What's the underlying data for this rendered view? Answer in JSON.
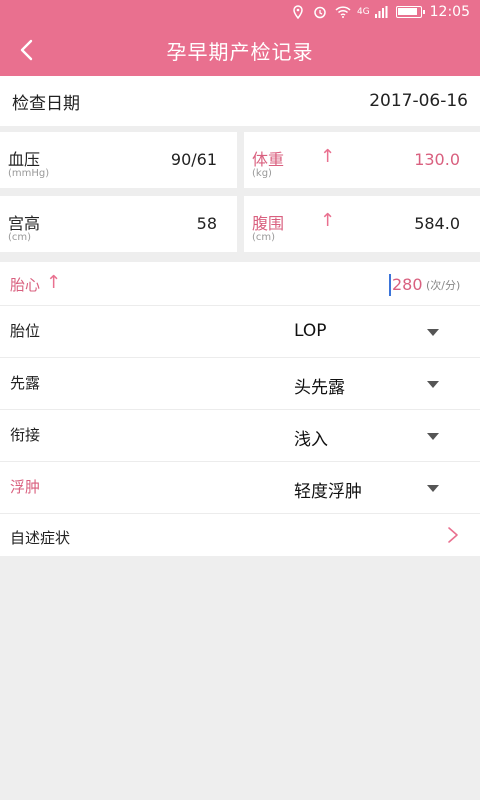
{
  "status": {
    "time": "12:05",
    "net": "4G"
  },
  "header": {
    "title": "孕早期产检记录"
  },
  "date": {
    "label": "检查日期",
    "value": "2017-06-16"
  },
  "cards": [
    {
      "label": "血压",
      "unit": "(mmHg)",
      "value": "90/61",
      "alert": false
    },
    {
      "label": "体重",
      "unit": "(kg)",
      "value": "130.0",
      "alert": true
    },
    {
      "label": "宫高",
      "unit": "(cm)",
      "value": "58",
      "alert": false
    },
    {
      "label": "腹围",
      "unit": "(cm)",
      "value": "584.0",
      "alert": true
    }
  ],
  "fetal_heart": {
    "label": "胎心",
    "value": "280",
    "unit": "(次/分)"
  },
  "selects": [
    {
      "label": "胎位",
      "value": "LOP",
      "alert": false
    },
    {
      "label": "先露",
      "value": "头先露",
      "alert": false
    },
    {
      "label": "衔接",
      "value": "浅入",
      "alert": false
    },
    {
      "label": "浮肿",
      "value": "轻度浮肿",
      "alert": true
    }
  ],
  "symptoms": {
    "label": "自述症状"
  },
  "colors": {
    "accent": "#e9708f",
    "alert_text": "#d9607f"
  }
}
